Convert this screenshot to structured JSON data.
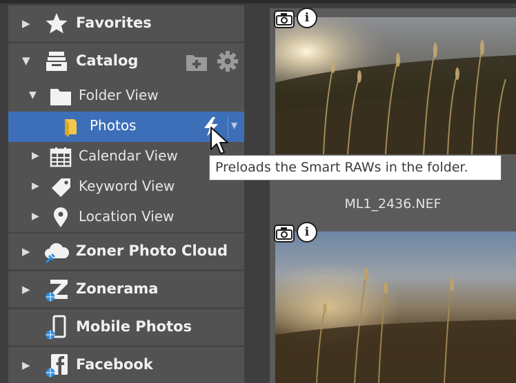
{
  "sidebar": {
    "favorites": {
      "label": "Favorites",
      "icon": "star-icon"
    },
    "catalog": {
      "label": "Catalog",
      "icon": "catalog-icon",
      "add_folder_icon": "add-folder-icon",
      "settings_icon": "gear-icon"
    },
    "tree": {
      "folder_view": {
        "label": "Folder View",
        "icon": "folder-icon"
      },
      "photos": {
        "label": "Photos",
        "icon": "folder-icon",
        "action_icon": "lightning-icon",
        "dropdown_icon": "dropdown-arrow-icon"
      },
      "calendar_view": {
        "label": "Calendar View",
        "icon": "calendar-icon"
      },
      "keyword_view": {
        "label": "Keyword View",
        "icon": "tag-icon"
      },
      "location_view": {
        "label": "Location View",
        "icon": "location-pin-icon"
      }
    },
    "zoner_photo_cloud": {
      "label": "Zoner Photo Cloud",
      "icon": "cloud-icon"
    },
    "zonerama": {
      "label": "Zonerama",
      "icon": "zonerama-icon"
    },
    "mobile_photos": {
      "label": "Mobile Photos",
      "icon": "smartphone-icon"
    },
    "facebook": {
      "label": "Facebook",
      "icon": "facebook-icon"
    }
  },
  "tooltip": {
    "text": "Preloads the Smart RAWs in the folder."
  },
  "thumbnails": [
    {
      "filename": "ML1_2436.NEF",
      "badges": [
        "camera-icon",
        "info-icon"
      ]
    },
    {
      "filename": "",
      "badges": [
        "camera-icon",
        "info-icon"
      ]
    }
  ],
  "colors": {
    "selection": "#3d6fb8",
    "panel": "#525252",
    "background": "#3e3e3e",
    "tooltip_bg": "#ffffff"
  }
}
